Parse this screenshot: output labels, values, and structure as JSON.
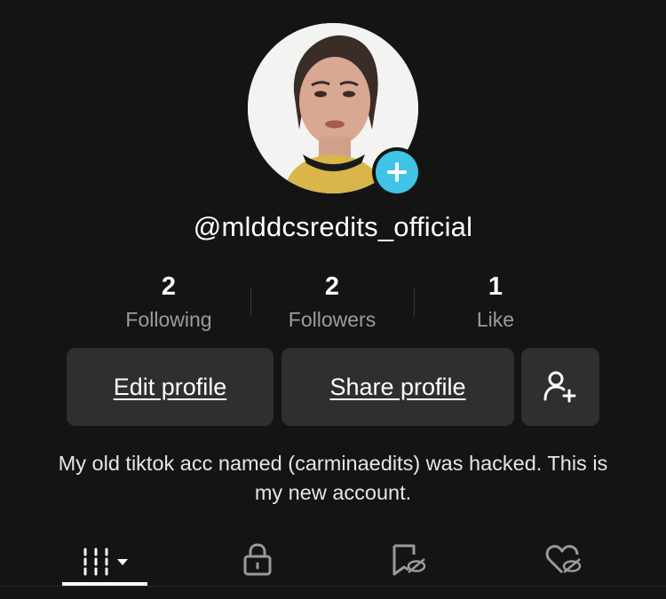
{
  "profile": {
    "username": "@mlddcsredits_official",
    "bio": "My old tiktok acc named (carminaedits) was hacked. This is my new account."
  },
  "stats": [
    {
      "value": "2",
      "label": "Following"
    },
    {
      "value": "2",
      "label": "Followers"
    },
    {
      "value": "1",
      "label": "Like"
    }
  ],
  "buttons": {
    "edit_profile": "Edit profile",
    "share_profile": "Share profile"
  },
  "icons": {
    "add_badge": "plus-icon",
    "add_friend": "add-user-icon",
    "tab_videos": "grid-icon",
    "tab_private": "lock-icon",
    "tab_saved": "bookmark-hidden-icon",
    "tab_liked": "heart-hidden-icon"
  },
  "colors": {
    "background": "#141414",
    "button_bg": "#2f2f2f",
    "badge": "#3fc4e8",
    "secondary_text": "#9c9c9c"
  }
}
